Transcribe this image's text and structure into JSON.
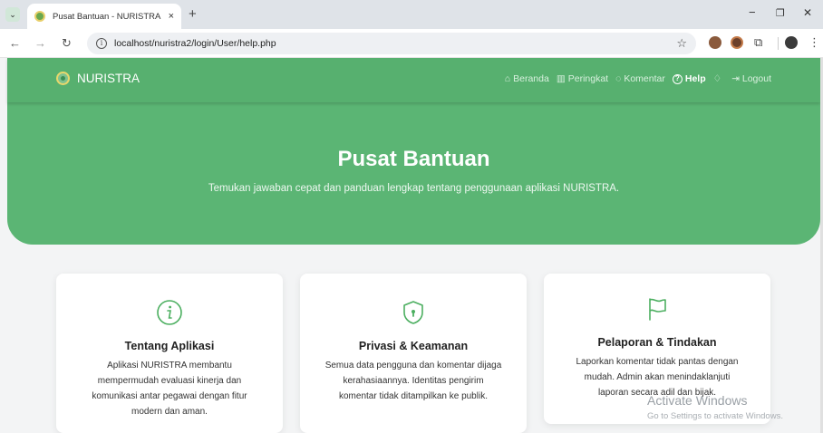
{
  "browser": {
    "tab_title": "Pusat Bantuan - NURISTRA",
    "tab_close": "×",
    "new_tab": "+",
    "url": "localhost/nuristra2/login/User/help.php",
    "tab_menu_icon": "⌄",
    "back": "←",
    "forward": "→",
    "reload": "↻",
    "star": "☆",
    "puzzle": "⧉",
    "kebab": "⋮",
    "minimize": "−",
    "restore": "❐",
    "close": "✕"
  },
  "navbar": {
    "brand": "NURISTRA",
    "items": [
      {
        "icon": "⌂",
        "label": "Beranda",
        "active": false
      },
      {
        "icon": "▥",
        "label": "Peringkat",
        "active": false
      },
      {
        "icon": "◌",
        "label": "Komentar",
        "active": false
      },
      {
        "icon": "?",
        "label": "Help",
        "active": true
      },
      {
        "icon": "♢",
        "label": "",
        "active": false
      },
      {
        "icon": "⇥",
        "label": "Logout",
        "active": false
      }
    ]
  },
  "hero": {
    "title": "Pusat Bantuan",
    "subtitle": "Temukan jawaban cepat dan panduan lengkap tentang penggunaan aplikasi NURISTRA."
  },
  "cards": [
    {
      "icon": "info-circle-icon",
      "title": "Tentang Aplikasi",
      "lines": [
        "Aplikasi NURISTRA membantu",
        "mempermudah evaluasi kinerja dan",
        "komunikasi antar pegawai dengan fitur",
        "modern dan aman."
      ]
    },
    {
      "icon": "shield-lock-icon",
      "title": "Privasi & Keamanan",
      "lines": [
        "Semua data pengguna dan komentar dijaga",
        "kerahasiaannya. Identitas pengirim",
        "komentar tidak ditampilkan ke publik."
      ]
    },
    {
      "icon": "flag-icon",
      "title": "Pelaporan & Tindakan",
      "lines": [
        "Laporkan komentar tidak pantas dengan",
        "mudah. Admin akan menindaklanjuti",
        "laporan secara adil dan bijak."
      ]
    }
  ],
  "watermark": {
    "line1": "Activate Windows",
    "line2": "Go to Settings to activate Windows."
  },
  "colors": {
    "primary_green": "#5bb574",
    "icon_green": "#4caf60"
  }
}
